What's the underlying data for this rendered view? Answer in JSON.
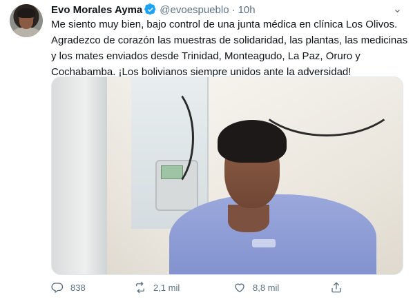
{
  "tweet": {
    "author_name": "Evo Morales Ayma",
    "handle": "@evoespueblo",
    "separator": "·",
    "time": "10h",
    "text_lines": [
      "Me siento muy bien, bajo control de una junta médica en clínica Los Olivos.",
      "Agradezco de corazón las muestras de solidaridad, las plantas, las medicinas",
      "y los mates enviados desde Trinidad, Monteagudo, La Paz, Oruro y",
      "Cochabamba. ¡Los bolivianos siempre unidos ante la adversidad!"
    ],
    "more_label": "⌄"
  },
  "icons": {
    "verified": "verified-badge-icon",
    "reply": "reply-icon",
    "retweet": "retweet-icon",
    "like": "like-icon",
    "share": "share-icon"
  },
  "colors": {
    "verified": "#1da1f2",
    "secondary_text": "#5b7083",
    "primary_text": "#0f1419"
  },
  "actions": {
    "reply_count": "838",
    "retweet_count": "2,1 mil",
    "like_count": "8,8 mil"
  }
}
